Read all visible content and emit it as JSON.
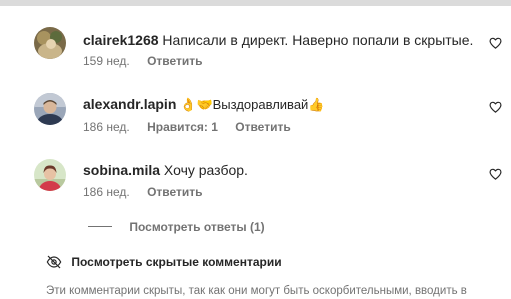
{
  "comments": [
    {
      "username": "clairek1268",
      "text": "Написали в директ. Наверно попали в скрытые.",
      "time": "159 нед.",
      "likes": "",
      "reply_label": "Ответить"
    },
    {
      "username": "alexandr.lapin",
      "text": "👌🤝Выздоравливай👍",
      "time": "186 нед.",
      "likes": "Нравится: 1",
      "reply_label": "Ответить"
    },
    {
      "username": "sobina.mila",
      "text": "Хочу разбор.",
      "time": "186 нед.",
      "likes": "",
      "reply_label": "Ответить"
    }
  ],
  "view_replies_label": "Посмотреть ответы (1)",
  "hidden_comments_label": "Посмотреть скрытые комментарии",
  "hidden_note": "Эти комментарии скрыты, так как они могут быть оскорбительными, вводить в",
  "icons": {
    "like": "heart-outline-icon",
    "hidden": "eye-off-icon"
  },
  "colors": {
    "text": "#262626",
    "secondary": "#737373"
  }
}
